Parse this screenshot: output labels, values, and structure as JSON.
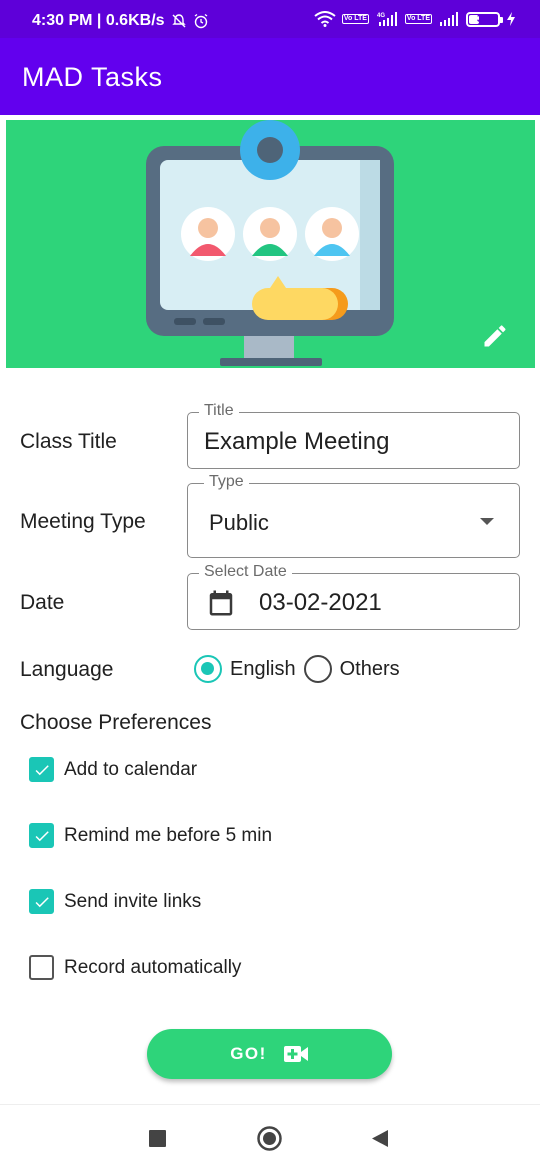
{
  "status_bar": {
    "time_info": "4:30 PM | 0.6KB/s",
    "lte_tag": "Vo LTE",
    "battery_level": "34"
  },
  "app_bar": {
    "title": "MAD Tasks"
  },
  "form": {
    "class_title": {
      "label": "Class Title",
      "legend": "Title",
      "value": "Example Meeting"
    },
    "meeting_type": {
      "label": "Meeting Type",
      "legend": "Type",
      "value": "Public"
    },
    "date": {
      "label": "Date",
      "legend": "Select Date",
      "value": "03-02-2021"
    },
    "language": {
      "label": "Language",
      "options": [
        {
          "label": "English",
          "selected": true
        },
        {
          "label": "Others",
          "selected": false
        }
      ]
    }
  },
  "preferences": {
    "title": "Choose Preferences",
    "items": [
      {
        "label": "Add to calendar",
        "checked": true
      },
      {
        "label": "Remind me before 5 min",
        "checked": true
      },
      {
        "label": "Send invite links",
        "checked": true
      },
      {
        "label": "Record automatically",
        "checked": false
      }
    ]
  },
  "go_button": {
    "label": "GO!"
  },
  "colors": {
    "status_bar": "#5e00d9",
    "app_bar": "#6200ee",
    "banner": "#2ed47a",
    "accent": "#1ac6b6",
    "go_button": "#2ed47a"
  },
  "icons": {
    "edit": "pencil-icon",
    "calendar": "calendar-icon",
    "video": "video-add-icon",
    "nav_recents": "square-icon",
    "nav_home": "circle-icon",
    "nav_back": "triangle-back-icon"
  }
}
